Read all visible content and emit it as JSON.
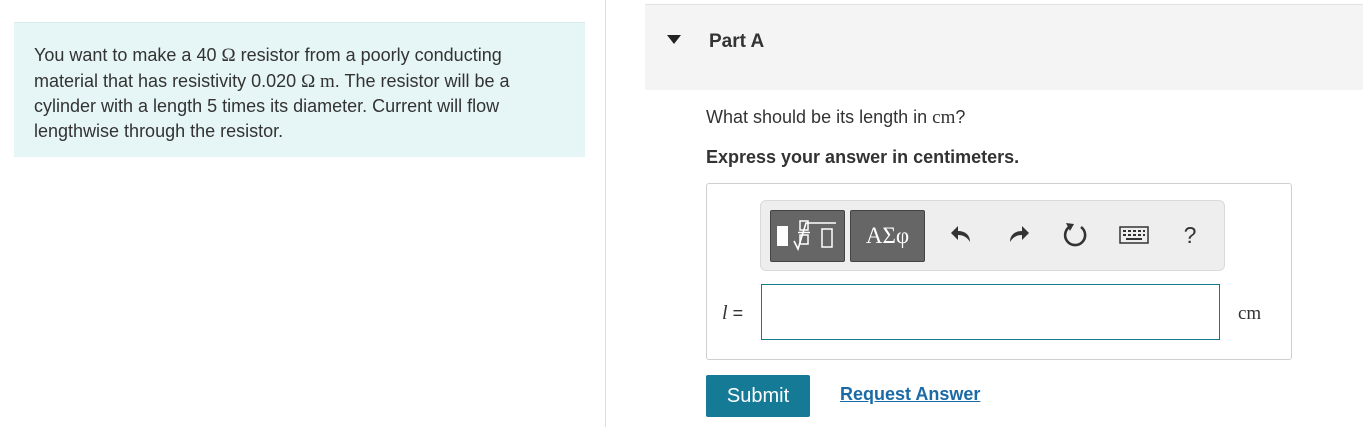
{
  "problem": {
    "line1_pre": "You want to make a 40 ",
    "ohm_1": "Ω",
    "line1_post": " resistor from a poorly conducting",
    "line2_pre": "material that has resistivity 0.020 ",
    "resistivity_unit": "Ω m",
    "line2_post": ". The resistor will be a",
    "line3": "cylinder with a length 5 times its diameter. Current will flow",
    "line4": "lengthwise through the resistor."
  },
  "part": {
    "title": "Part A"
  },
  "question": {
    "text_pre": "What should be its length in ",
    "unit": "cm",
    "text_post": "?",
    "instruction": "Express your answer in centimeters."
  },
  "toolbar": {
    "greek_label": "ΑΣφ",
    "help_label": "?",
    "icons": [
      "templates-icon",
      "undo-icon",
      "redo-icon",
      "reset-icon",
      "keyboard-icon",
      "help-icon"
    ]
  },
  "answer": {
    "variable": "l",
    "equals": " =",
    "value": "",
    "unit": "cm"
  },
  "actions": {
    "submit_label": "Submit",
    "request_label": "Request Answer"
  },
  "colors": {
    "problem_bg": "#e6f5f5",
    "submit_bg": "#157a96",
    "link": "#1b6aa5",
    "input_border": "#147b8a"
  }
}
